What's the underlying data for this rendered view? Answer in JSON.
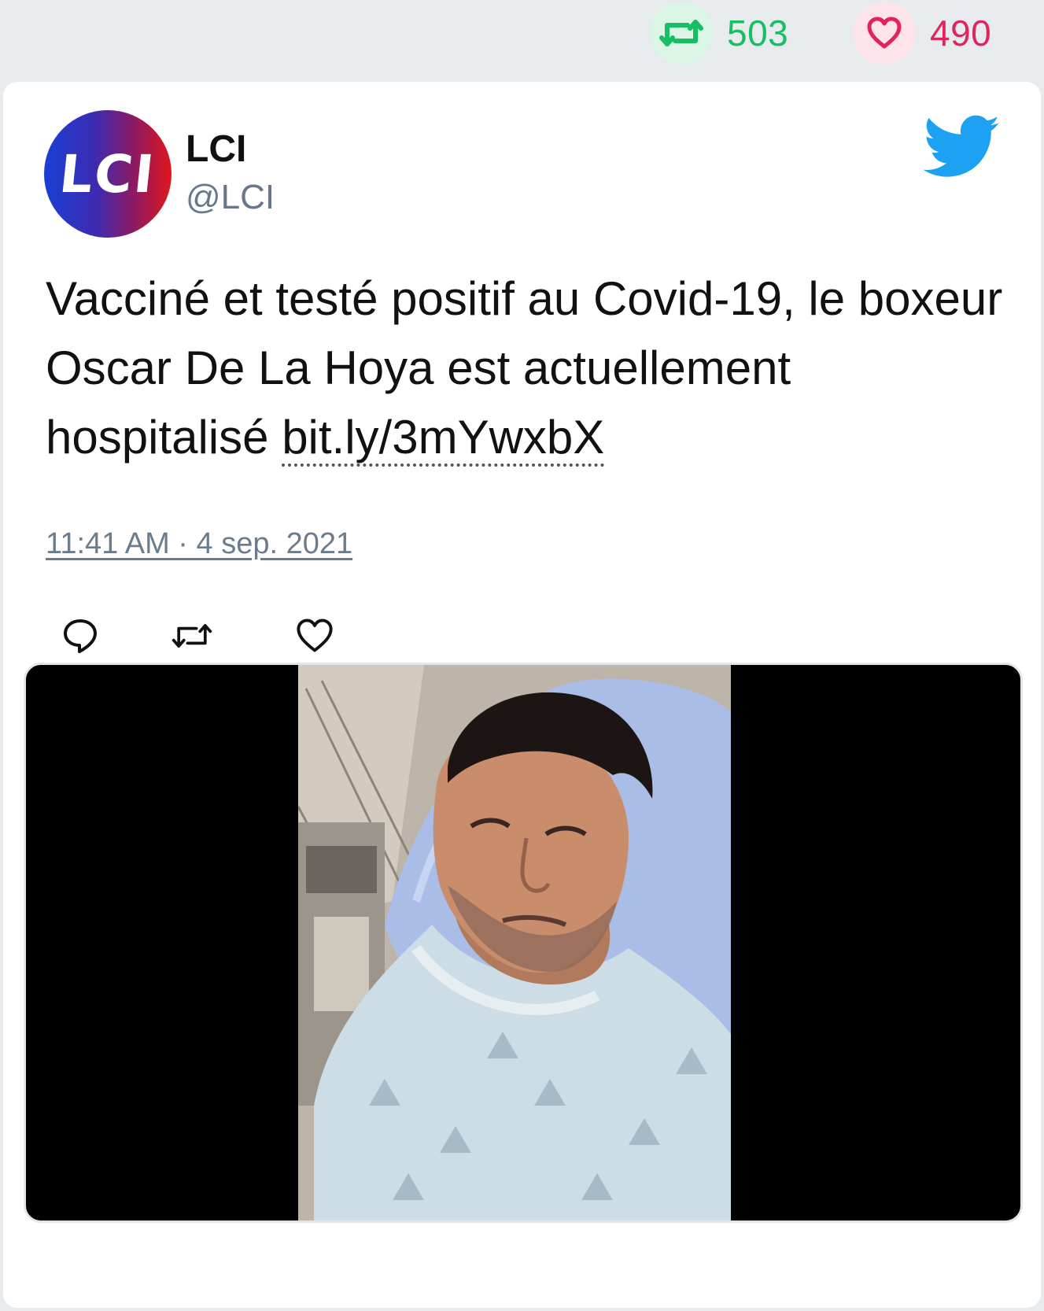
{
  "stats": {
    "retweets": "503",
    "likes": "490",
    "retweet_color": "#17bf63",
    "like_color": "#e0245e"
  },
  "tweet": {
    "avatar_text": "LCI",
    "display_name": "LCI",
    "handle": "@LCI",
    "text": "Vacciné et testé positif au Covid-19, le boxeur Oscar De La Hoya est actuellement hospitalisé ",
    "link": "bit.ly/3mYwxbX",
    "timestamp": "11:41 AM · 4 sep. 2021"
  },
  "icons": {
    "brand": "twitter-bird-icon",
    "actions": [
      "reply-icon",
      "retweet-icon",
      "like-icon"
    ]
  }
}
